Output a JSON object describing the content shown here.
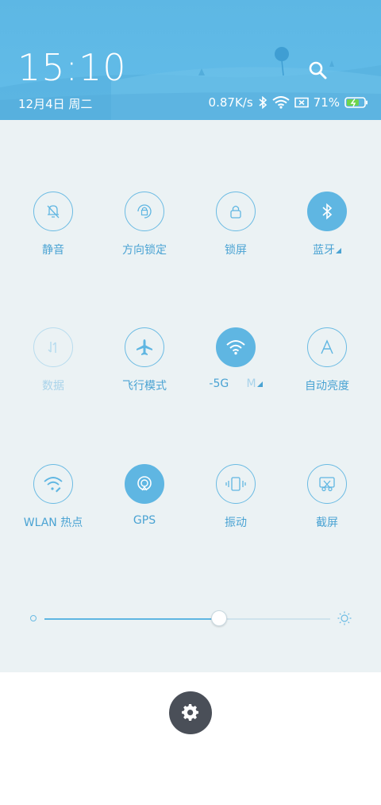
{
  "header": {
    "time": "15:10",
    "date": "12月4日 周二",
    "net_speed": "0.87K/s",
    "battery_percent": "71%",
    "battery_level": 0.71
  },
  "tiles": [
    {
      "label": "静音",
      "icon": "bell-off-icon",
      "state": "off"
    },
    {
      "label": "方向锁定",
      "icon": "rotation-lock-icon",
      "state": "off"
    },
    {
      "label": "锁屏",
      "icon": "lock-icon",
      "state": "off"
    },
    {
      "label": "蓝牙",
      "icon": "bluetooth-icon",
      "state": "on",
      "has_more": true
    },
    {
      "label": "数据",
      "icon": "mobile-data-icon",
      "state": "disabled"
    },
    {
      "label": "飞行模式",
      "icon": "airplane-icon",
      "state": "off"
    },
    {
      "label_part1": "-5G",
      "label_part2": "M",
      "icon": "wifi-icon",
      "state": "on",
      "has_more": true
    },
    {
      "label": "自动亮度",
      "icon": "auto-brightness-icon",
      "state": "off"
    },
    {
      "label": "WLAN 热点",
      "icon": "hotspot-icon",
      "state": "off"
    },
    {
      "label": "GPS",
      "icon": "gps-icon",
      "state": "on"
    },
    {
      "label": "振动",
      "icon": "vibrate-icon",
      "state": "off"
    },
    {
      "label": "截屏",
      "icon": "screenshot-icon",
      "state": "off"
    }
  ],
  "brightness": {
    "level": 0.61
  },
  "colors": {
    "accent": "#5fb6e2",
    "panel_bg": "#ebf2f4",
    "settings_bg": "#4a4f58"
  }
}
